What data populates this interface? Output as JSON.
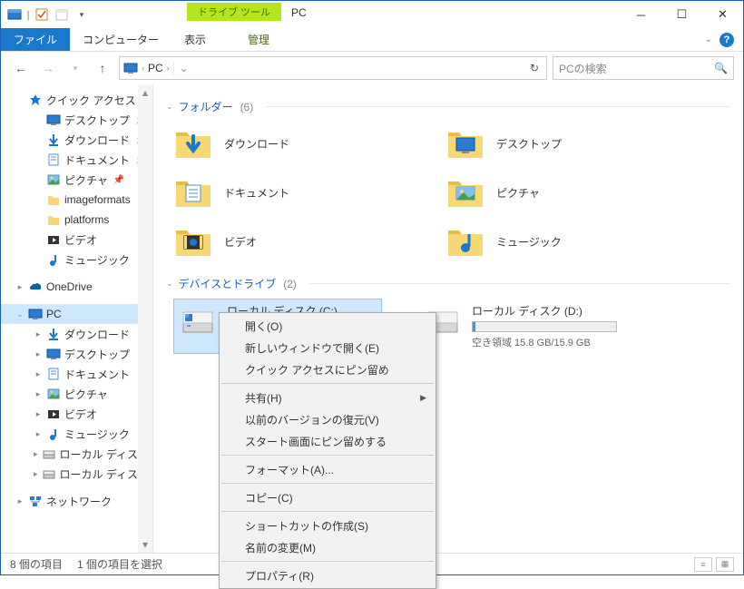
{
  "window": {
    "title": "PC",
    "drive_tools_label": "ドライブ ツール"
  },
  "ribbon": {
    "file": "ファイル",
    "tabs": [
      "コンピューター",
      "表示"
    ],
    "contextual_tab": "管理"
  },
  "nav": {
    "address_root": "PC",
    "search_placeholder": "PCの検索"
  },
  "sidebar": {
    "quick_access": "クイック アクセス",
    "quick_items": [
      {
        "label": "デスクトップ",
        "pinned": true,
        "icon": "desktop"
      },
      {
        "label": "ダウンロード",
        "pinned": true,
        "icon": "downloads"
      },
      {
        "label": "ドキュメント",
        "pinned": true,
        "icon": "documents"
      },
      {
        "label": "ピクチャ",
        "pinned": true,
        "icon": "pictures"
      },
      {
        "label": "imageformats",
        "pinned": false,
        "icon": "folder"
      },
      {
        "label": "platforms",
        "pinned": false,
        "icon": "folder"
      },
      {
        "label": "ビデオ",
        "pinned": false,
        "icon": "videos"
      },
      {
        "label": "ミュージック",
        "pinned": false,
        "icon": "music"
      }
    ],
    "onedrive": "OneDrive",
    "pc": "PC",
    "pc_items": [
      {
        "label": "ダウンロード",
        "icon": "downloads"
      },
      {
        "label": "デスクトップ",
        "icon": "desktop"
      },
      {
        "label": "ドキュメント",
        "icon": "documents"
      },
      {
        "label": "ピクチャ",
        "icon": "pictures"
      },
      {
        "label": "ビデオ",
        "icon": "videos"
      },
      {
        "label": "ミュージック",
        "icon": "music"
      },
      {
        "label": "ローカル ディスク (C",
        "icon": "disk"
      },
      {
        "label": "ローカル ディスク (D",
        "icon": "disk"
      }
    ],
    "network": "ネットワーク"
  },
  "content": {
    "folders_header": "フォルダー",
    "folders_count": "(6)",
    "folders": [
      {
        "label": "ダウンロード",
        "icon": "downloads"
      },
      {
        "label": "デスクトップ",
        "icon": "desktop"
      },
      {
        "label": "ドキュメント",
        "icon": "documents"
      },
      {
        "label": "ピクチャ",
        "icon": "pictures"
      },
      {
        "label": "ビデオ",
        "icon": "videos"
      },
      {
        "label": "ミュージック",
        "icon": "music"
      }
    ],
    "drives_header": "デバイスとドライブ",
    "drives_count": "(2)",
    "drives": [
      {
        "label": "ローカル ディスク (C:)",
        "selected": true
      },
      {
        "label": "ローカル ディスク (D:)",
        "selected": false,
        "free_text": "空き領域 15.8 GB/15.9 GB",
        "fill_pct": 2
      }
    ]
  },
  "context_menu": {
    "items": [
      {
        "label": "開く(O)",
        "type": "item"
      },
      {
        "label": "新しいウィンドウで開く(E)",
        "type": "item"
      },
      {
        "label": "クイック アクセスにピン留め",
        "type": "item"
      },
      {
        "type": "sep"
      },
      {
        "label": "共有(H)",
        "type": "submenu"
      },
      {
        "label": "以前のバージョンの復元(V)",
        "type": "item"
      },
      {
        "label": "スタート画面にピン留めする",
        "type": "item"
      },
      {
        "type": "sep"
      },
      {
        "label": "フォーマット(A)...",
        "type": "item"
      },
      {
        "type": "sep"
      },
      {
        "label": "コピー(C)",
        "type": "item"
      },
      {
        "type": "sep"
      },
      {
        "label": "ショートカットの作成(S)",
        "type": "item"
      },
      {
        "label": "名前の変更(M)",
        "type": "item"
      },
      {
        "type": "sep"
      },
      {
        "label": "プロパティ(R)",
        "type": "item"
      }
    ]
  },
  "status": {
    "items_count": "8 個の項目",
    "selected": "1 個の項目を選択"
  },
  "icon_glyphs": {
    "desktop": "🖥️",
    "downloads": "⬇",
    "documents": "📄",
    "pictures": "🖼️",
    "folder": "📁",
    "videos": "🎞️",
    "music": "♪",
    "disk": "💽",
    "onedrive": "☁",
    "pc": "🖥️",
    "network": "🖧"
  }
}
